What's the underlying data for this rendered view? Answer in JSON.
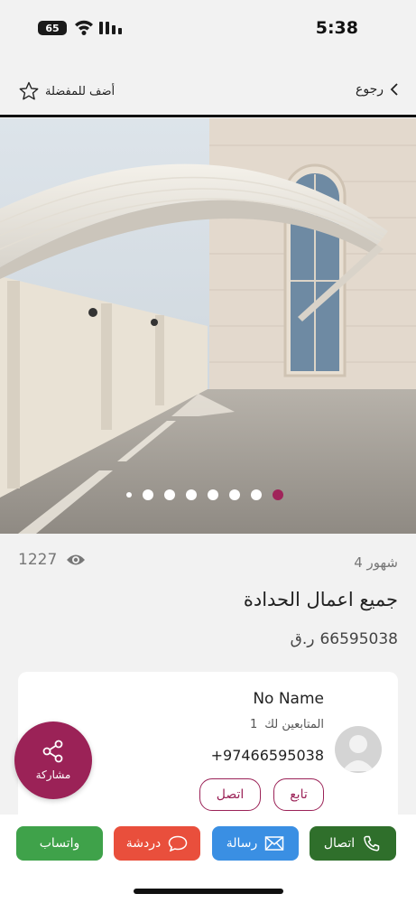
{
  "status_bar": {
    "battery": "65",
    "time": "5:38"
  },
  "nav": {
    "back_label": "رجوع",
    "favorite_label": "أضف للمفضلة"
  },
  "gallery": {
    "image_count": 7,
    "active_index": 0
  },
  "listing": {
    "views": "1227",
    "age": "4 شهور",
    "title": "جميع  اعمال الحدادة",
    "price_value": "66595038",
    "price_currency": "ر.ق"
  },
  "seller": {
    "name": "No Name",
    "followers_label": "المتابعين لك",
    "followers_count": "1",
    "phone": "+97466595038",
    "follow_label": "تابع",
    "call_label": "اتصل"
  },
  "share": {
    "label": "مشاركة"
  },
  "actions": {
    "call": "اتصال",
    "message": "رسالة",
    "chat": "دردشة",
    "whatsapp": "واتساب"
  },
  "colors": {
    "brand": "#9b2257",
    "call": "#2f6f2b",
    "message": "#3a8fe3",
    "chat": "#e94f3c",
    "whatsapp": "#3fa24a"
  }
}
